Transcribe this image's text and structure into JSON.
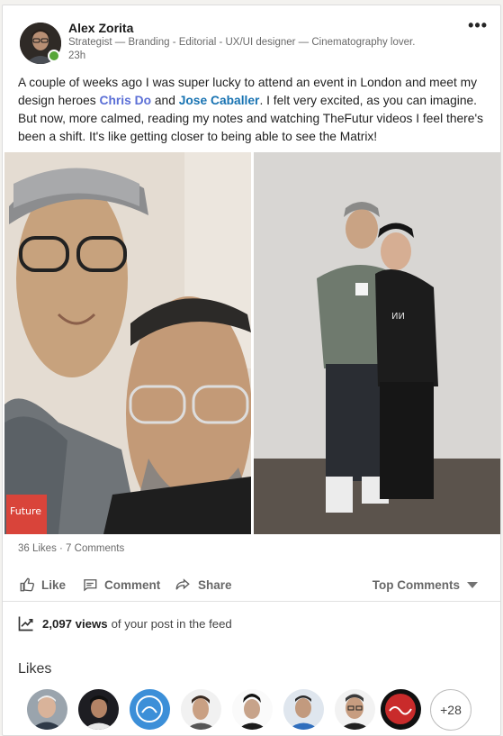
{
  "post": {
    "author": {
      "name": "Alex Zorita",
      "headline": "Strategist — Branding - Editorial - UX/UI designer — Cinematography lover.",
      "time": "23h",
      "online": true
    },
    "text": {
      "part1": "A couple of weeks ago I was super lucky to attend an event in London and meet my design heroes ",
      "mention1": "Chris Do",
      "part2": " and ",
      "mention2": "Jose Caballer",
      "part3": ". I felt very excited, as you can imagine. But now, more calmed, reading my notes and watching TheFutur videos I feel there's been a shift. It's like getting closer to being able to see the Matrix!"
    },
    "stats": "36 Likes · 7 Comments",
    "actions": {
      "like": "Like",
      "comment": "Comment",
      "share": "Share",
      "sort": "Top Comments"
    },
    "views": {
      "count": "2,097 views",
      "suffix": "of your post in the feed"
    },
    "likes_section": {
      "title": "Likes",
      "more": "+28"
    }
  },
  "colors": {
    "mention": "#5b6fd6",
    "mention_alt": "#1873b2",
    "online": "#57a639"
  }
}
